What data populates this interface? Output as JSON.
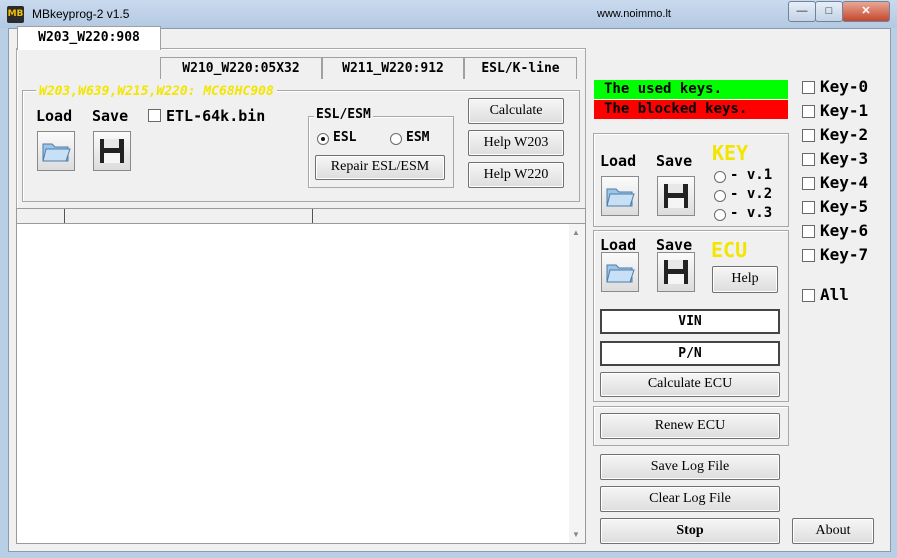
{
  "window": {
    "title": "MBkeyprog-2  v1.5",
    "url": "www.noimmo.lt",
    "app_icon": "MB",
    "minimize": "—",
    "maximize": "□",
    "close": "✕"
  },
  "tabs": [
    {
      "label": "W203_W220:908",
      "active": true
    },
    {
      "label": "W210_W220:05X32"
    },
    {
      "label": "W211_W220:912"
    },
    {
      "label": "ESL/K-line"
    }
  ],
  "top_panel": {
    "subtitle": "W203,W639,W215,W220: MC68HC908",
    "load_label": "Load",
    "save_label": "Save",
    "etl_checkbox_label": "ETL-64k.bin",
    "esl_group_title": "ESL/ESM",
    "radio_esl": "ESL",
    "radio_esm": "ESM",
    "repair_button": "Repair ESL/ESM",
    "calculate_button": "Calculate",
    "help_w203_button": "Help W203",
    "help_w220_button": "Help W220"
  },
  "legend": {
    "used_keys": "The used keys.",
    "blocked_keys": "The blocked keys.",
    "used_color": "#00ff00",
    "blocked_color": "#ff0000"
  },
  "key_panel": {
    "load_label": "Load",
    "save_label": "Save",
    "title": "KEY",
    "versions": [
      "- v.1",
      "- v.2",
      "- v.3"
    ]
  },
  "ecu_panel": {
    "load_label": "Load",
    "save_label": "Save",
    "title": "ECU",
    "help_button": "Help",
    "vin_field": "VIN",
    "pn_field": "P/N",
    "calculate_button": "Calculate  ECU"
  },
  "renew_button": "Renew      ECU",
  "keys": [
    "Key-0",
    "Key-1",
    "Key-2",
    "Key-3",
    "Key-4",
    "Key-5",
    "Key-6",
    "Key-7"
  ],
  "all_label": "All",
  "bottom": {
    "save_log": "Save  Log  File",
    "clear_log": "Clear Log  File",
    "stop": "Stop",
    "about": "About"
  },
  "scroll": {
    "up": "▲",
    "down": "▼"
  },
  "icons": {
    "load": "folder-icon",
    "save": "floppy-disk-icon"
  }
}
